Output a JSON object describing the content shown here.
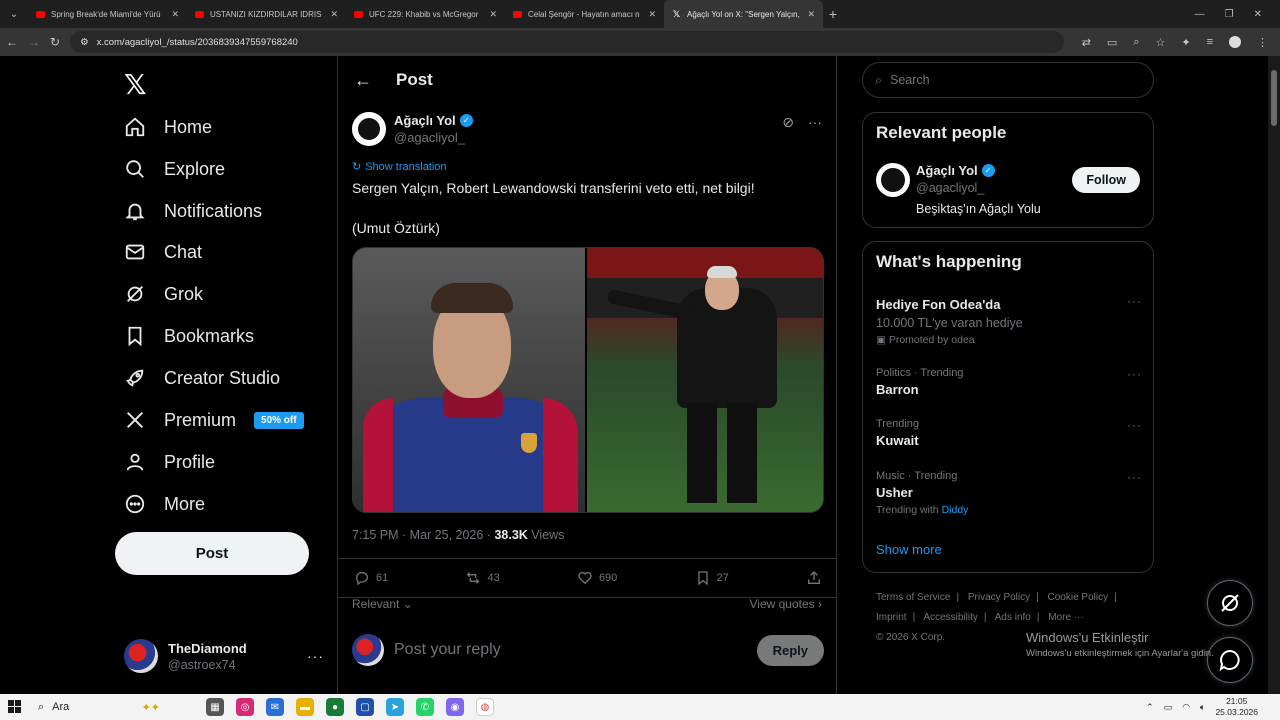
{
  "browser": {
    "tabs": [
      {
        "title": "Spring Break'de Miami'de Yürü",
        "active": false,
        "icon": "youtube-icon"
      },
      {
        "title": "USTANIZI KIZDIRDILAR IDRIS U",
        "active": false,
        "icon": "youtube-icon"
      },
      {
        "title": "UFC 229: Khabib vs McGregor",
        "active": false,
        "icon": "youtube-icon"
      },
      {
        "title": "Celal Şengör - Hayatın amacı n",
        "active": false,
        "icon": "youtube-icon"
      },
      {
        "title": "Ağaçlı Yol on X: \"Sergen Yalçın,",
        "active": true,
        "icon": "x-icon"
      }
    ],
    "url": "x.com/agacliyol_/status/2036839347559768240"
  },
  "nav": {
    "items": [
      {
        "label": "Home",
        "icon": "home-icon"
      },
      {
        "label": "Explore",
        "icon": "search-icon"
      },
      {
        "label": "Notifications",
        "icon": "bell-icon"
      },
      {
        "label": "Chat",
        "icon": "mail-icon"
      },
      {
        "label": "Grok",
        "icon": "grok-icon"
      },
      {
        "label": "Bookmarks",
        "icon": "bookmark-icon"
      },
      {
        "label": "Creator Studio",
        "icon": "rocket-icon"
      },
      {
        "label": "Premium",
        "icon": "x-icon"
      },
      {
        "label": "Profile",
        "icon": "person-icon"
      },
      {
        "label": "More",
        "icon": "more-circle-icon"
      }
    ],
    "premium_badge": "50% off",
    "post_button": "Post",
    "account": {
      "name": "TheDiamond",
      "handle": "@astroex74"
    }
  },
  "post": {
    "header_title": "Post",
    "author_name": "Ağaçlı Yol",
    "author_handle": "@agacliyol_",
    "show_translation": "Show translation",
    "text_line1": "Sergen Yalçın, Robert Lewandowski transferini veto etti, net bilgi!",
    "text_line2": "(Umut Öztürk)",
    "time": "7:15 PM · Mar 25, 2026 · ",
    "views_count": "38.3K",
    "views_label": "Views",
    "replies": "61",
    "reposts": "43",
    "likes": "690",
    "bookmarks": "27",
    "relevant": "Relevant",
    "view_quotes": "View quotes",
    "reply_placeholder": "Post your reply",
    "reply_button": "Reply"
  },
  "sidebar": {
    "search_placeholder": "Search",
    "relevant_people_title": "Relevant people",
    "person": {
      "name": "Ağaçlı Yol",
      "handle": "@agacliyol_",
      "bio": "Beşiktaş'ın Ağaçlı Yolu",
      "follow": "Follow"
    },
    "whats_happening_title": "What's happening",
    "trends": [
      {
        "name": "Hediye Fon Odea'da",
        "sub": "10.000 TL'ye varan hediye",
        "sub2": "Promoted by odea"
      },
      {
        "category": "Politics · Trending",
        "name": "Barron"
      },
      {
        "category": "Trending",
        "name": "Kuwait"
      },
      {
        "category": "Music · Trending",
        "name": "Usher",
        "with_label": "Trending with",
        "with_link": "Diddy"
      }
    ],
    "show_more": "Show more",
    "footer": [
      "Terms of Service",
      "|",
      "Privacy Policy",
      "|",
      "Cookie Policy",
      "|",
      "Imprint",
      "|",
      "Accessibility",
      "|",
      "Ads info",
      "|",
      "More ···",
      "© 2026 X Corp."
    ]
  },
  "windows": {
    "activate_title": "Windows'u Etkinleştir",
    "activate_sub": "Windows'u etkinleştirmek için Ayarlar'a gidin.",
    "search": "Ara",
    "time": "21:05",
    "date": "25.03.2026"
  }
}
